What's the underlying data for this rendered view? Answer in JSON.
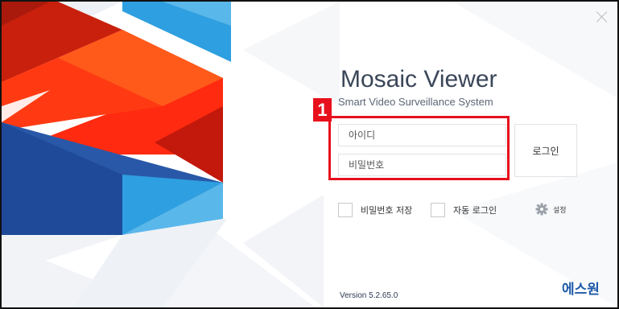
{
  "app": {
    "title": "Mosaic Viewer",
    "subtitle": "Smart Video Surveillance System",
    "version": "Version 5.2.65.0",
    "brand": "에스원"
  },
  "login": {
    "id_placeholder": "아이디",
    "pw_placeholder": "비밀번호",
    "button_label": "로그인"
  },
  "options": {
    "save_password_label": "비밀번호 저장",
    "save_password_checked": false,
    "auto_login_label": "자동 로그인",
    "auto_login_checked": false,
    "settings_label": "설정",
    "settings_icon": "gear-icon"
  },
  "annotation": {
    "step_number": "1",
    "color": "#e8101d"
  },
  "colors": {
    "brand_blue": "#1f5aa8",
    "accent_red": "#ff2a0f",
    "accent_blue": "#2e9fe0",
    "dark_blue": "#2a58a8"
  }
}
